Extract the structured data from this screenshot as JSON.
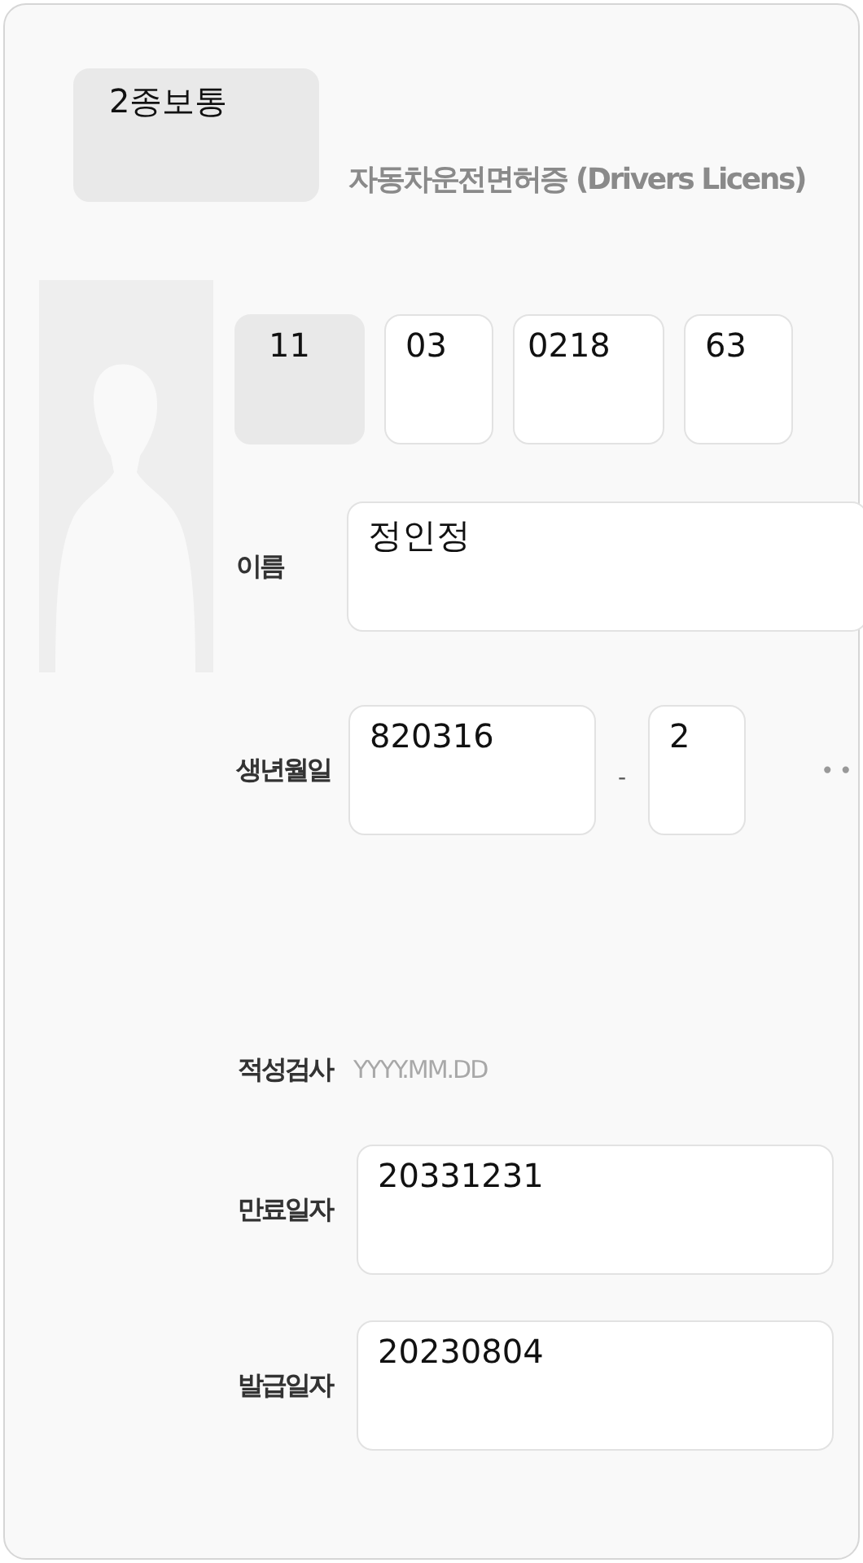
{
  "license_type": {
    "value": "2종보통",
    "disabled": true
  },
  "title": "자동차운전면허증 (Drivers Licens)",
  "license_number": [
    {
      "value": "11",
      "disabled": true
    },
    {
      "value": "03",
      "disabled": false
    },
    {
      "value": "0218",
      "disabled": false
    },
    {
      "value": "63",
      "disabled": false
    }
  ],
  "name": {
    "label": "이름",
    "value": "정인정"
  },
  "birth": {
    "label": "생년월일",
    "value": "820316",
    "separator": "-",
    "gender_digit": "2",
    "masked": "••"
  },
  "aptitude_test": {
    "label": "적성검사",
    "placeholder": "YYYY.MM.DD"
  },
  "expiry_date": {
    "label": "만료일자",
    "value": "20331231"
  },
  "issue_date": {
    "label": "발급일자",
    "value": "20230804"
  }
}
